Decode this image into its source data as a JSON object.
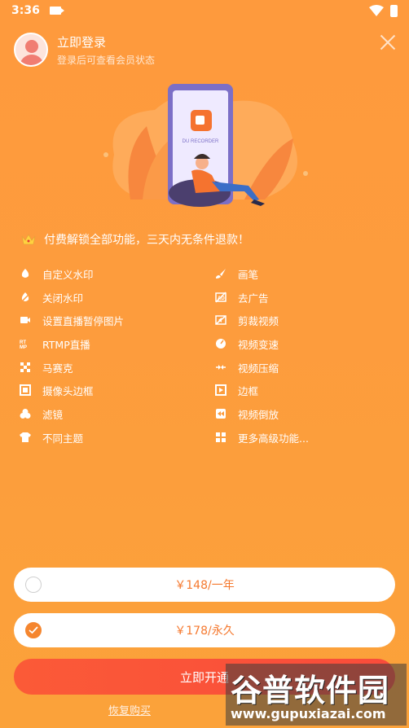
{
  "status_bar": {
    "time": "3:36"
  },
  "login": {
    "title": "立即登录",
    "subtitle": "登录后可查看会员状态"
  },
  "hero": {
    "app_name": "DU RECORDER"
  },
  "headline": "付费解锁全部功能，三天内无条件退款！",
  "features_left": [
    {
      "label": "自定义水印",
      "icon": "custom-watermark-icon"
    },
    {
      "label": "关闭水印",
      "icon": "remove-watermark-icon"
    },
    {
      "label": "设置直播暂停图片",
      "icon": "live-pause-image-icon"
    },
    {
      "label": "RTMP直播",
      "icon": "rtmp-icon"
    },
    {
      "label": "马赛克",
      "icon": "mosaic-icon"
    },
    {
      "label": "摄像头边框",
      "icon": "camera-frame-icon"
    },
    {
      "label": "滤镜",
      "icon": "filter-icon"
    },
    {
      "label": "不同主题",
      "icon": "theme-icon"
    }
  ],
  "features_right": [
    {
      "label": "画笔",
      "icon": "brush-icon"
    },
    {
      "label": "去广告",
      "icon": "remove-ads-icon"
    },
    {
      "label": "剪裁视频",
      "icon": "crop-video-icon"
    },
    {
      "label": "视频变速",
      "icon": "video-speed-icon"
    },
    {
      "label": "视频压缩",
      "icon": "video-compress-icon"
    },
    {
      "label": "边框",
      "icon": "frame-icon"
    },
    {
      "label": "视频倒放",
      "icon": "video-reverse-icon"
    },
    {
      "label": "更多高级功能...",
      "icon": "more-features-icon"
    }
  ],
  "plans": [
    {
      "label": "￥148/一年",
      "selected": false
    },
    {
      "label": "￥178/永久",
      "selected": true
    }
  ],
  "cta_label": "立即开通",
  "restore_label": "恢复购买",
  "watermark": {
    "title": "谷普软件园",
    "url": "www.gupuxiazai.com"
  },
  "colors": {
    "accent": "#f5792f",
    "cta": "#fb5a37",
    "background": "#fe9a3d"
  }
}
